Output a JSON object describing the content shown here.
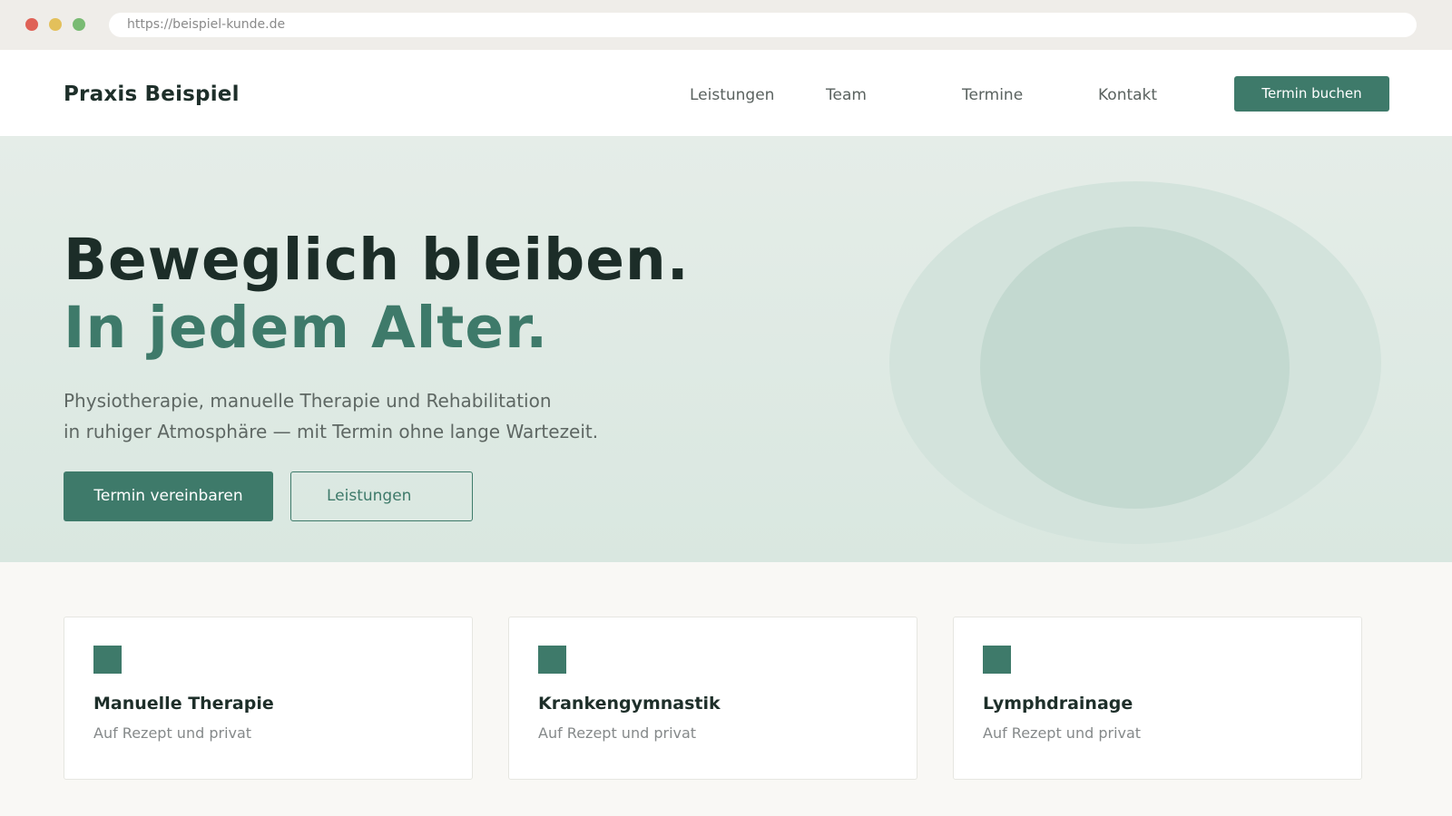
{
  "browser": {
    "url": "https://beispiel-kunde.de"
  },
  "header": {
    "brand": "Praxis Beispiel",
    "nav": [
      "Leistungen",
      "Team",
      "Termine",
      "Kontakt"
    ],
    "cta": "Termin buchen"
  },
  "hero": {
    "headline_1": "Beweglich bleiben.",
    "headline_2": "In jedem Alter.",
    "lead_line_1": "Physiotherapie, manuelle Therapie und Rehabilitation",
    "lead_line_2": "in ruhiger Atmosphäre — mit Termin ohne lange Wartezeit.",
    "primary_button": "Termin vereinbaren",
    "secondary_button": "Leistungen"
  },
  "services": [
    {
      "title": "Manuelle Therapie",
      "subtitle": "Auf Rezept und privat"
    },
    {
      "title": "Krankengymnastik",
      "subtitle": "Auf Rezept und privat"
    },
    {
      "title": "Lymphdrainage",
      "subtitle": "Auf Rezept und privat"
    }
  ],
  "colors": {
    "accent": "#3e7a6a",
    "heading": "#1c2d28",
    "hero_background": "#e5ede8"
  }
}
